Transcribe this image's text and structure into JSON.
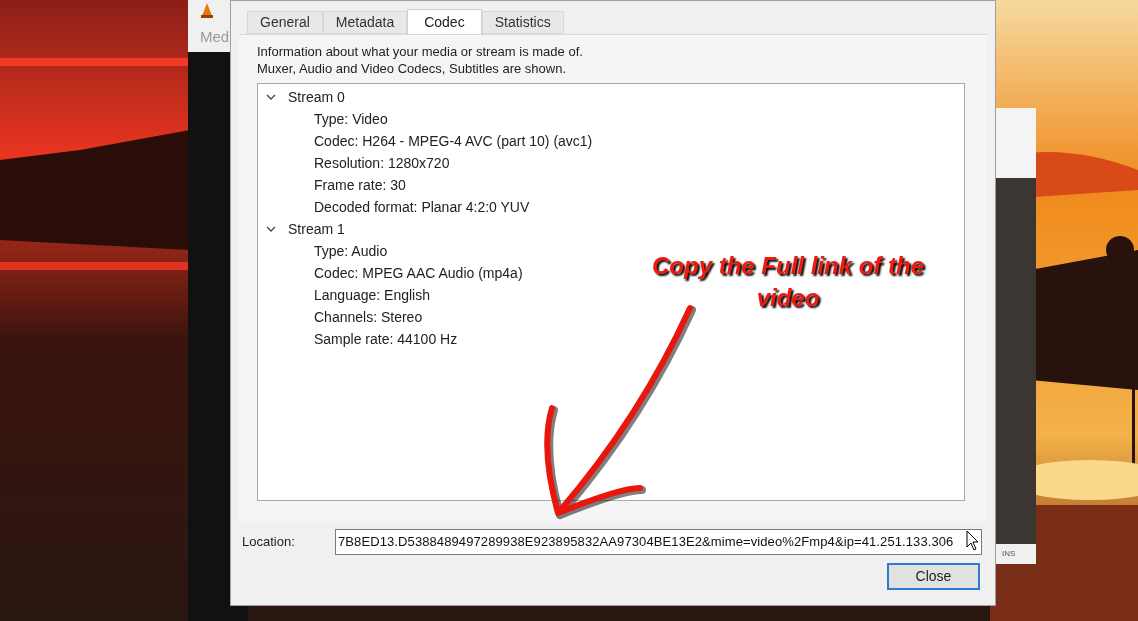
{
  "background_window": {
    "menu": "Med"
  },
  "side_window": {
    "status": "INS"
  },
  "dialog": {
    "tabs": [
      {
        "label": "General",
        "selected": false
      },
      {
        "label": "Metadata",
        "selected": false
      },
      {
        "label": "Codec",
        "selected": true
      },
      {
        "label": "Statistics",
        "selected": false
      }
    ],
    "description": [
      "Information about what your media or stream is made of.",
      "Muxer, Audio and Video Codecs, Subtitles are shown."
    ],
    "tree": [
      {
        "label": "Stream 0",
        "expanded": true,
        "children": [
          {
            "label": "Type: Video"
          },
          {
            "label": "Codec: H264 - MPEG-4 AVC (part 10) (avc1)"
          },
          {
            "label": "Resolution: 1280x720"
          },
          {
            "label": "Frame rate: 30"
          },
          {
            "label": "Decoded format: Planar 4:2:0 YUV"
          }
        ]
      },
      {
        "label": "Stream 1",
        "expanded": true,
        "children": [
          {
            "label": "Type: Audio"
          },
          {
            "label": "Codec: MPEG AAC Audio (mp4a)"
          },
          {
            "label": "Language: English"
          },
          {
            "label": "Channels: Stereo"
          },
          {
            "label": "Sample rate: 44100 Hz"
          }
        ]
      }
    ],
    "location": {
      "label": "Location:",
      "value": "7B8ED13.D5388489497289938E923895832AA97304BE13E2&mime=video%2Fmp4&ip=41.251.133.306"
    },
    "buttons": [
      {
        "label": "Close"
      }
    ]
  },
  "annotation": {
    "text": "Copy the Full link of the video"
  }
}
